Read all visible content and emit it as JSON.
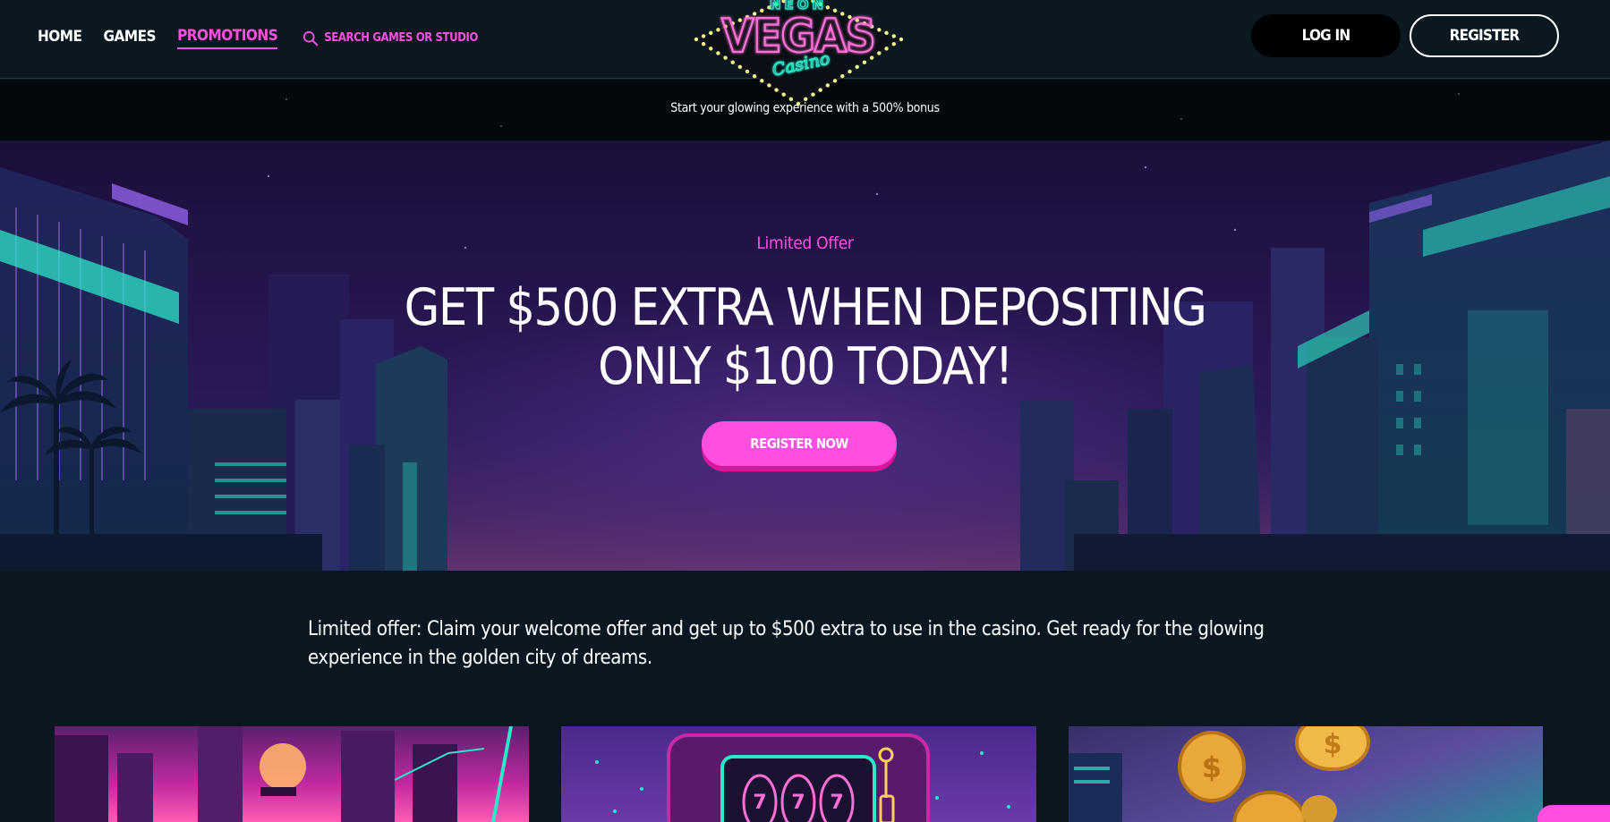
{
  "logo": {
    "top_text": "NEON",
    "main_text": "VEGAS",
    "script_text": "Casino"
  },
  "nav": {
    "items": [
      {
        "label": "HOME",
        "active": false
      },
      {
        "label": "GAMES",
        "active": false
      },
      {
        "label": "PROMOTIONS",
        "active": true
      }
    ],
    "search_placeholder": "SEARCH GAMES OR STUDIO"
  },
  "auth": {
    "login_label": "LOG IN",
    "register_label": "REGISTER"
  },
  "strip": {
    "text": "Start your glowing experience with a 500% bonus"
  },
  "hero": {
    "eyebrow": "Limited Offer",
    "title_line1": "GET $500 EXTRA WHEN DEPOSITING",
    "title_line2": "ONLY $100 TODAY!",
    "cta_label": "REGISTER NOW"
  },
  "intro": {
    "text": "Limited offer: Claim your welcome offer and get up to $500 extra to use in the casino. Get ready for the glowing experience in the golden city of dreams."
  },
  "cards": [
    {
      "id": "card-city"
    },
    {
      "id": "card-slot",
      "reels": [
        "7",
        "7",
        "7"
      ]
    },
    {
      "id": "card-coins"
    }
  ],
  "colors": {
    "accent": "#ff4fe0",
    "accent_shadow": "#d6179a",
    "background": "#0a1720",
    "strip_bg": "#03080c",
    "neon_teal": "#2ee6c8",
    "neon_pink": "#ff6fd8",
    "bulb_yellow": "#f7f08a"
  }
}
